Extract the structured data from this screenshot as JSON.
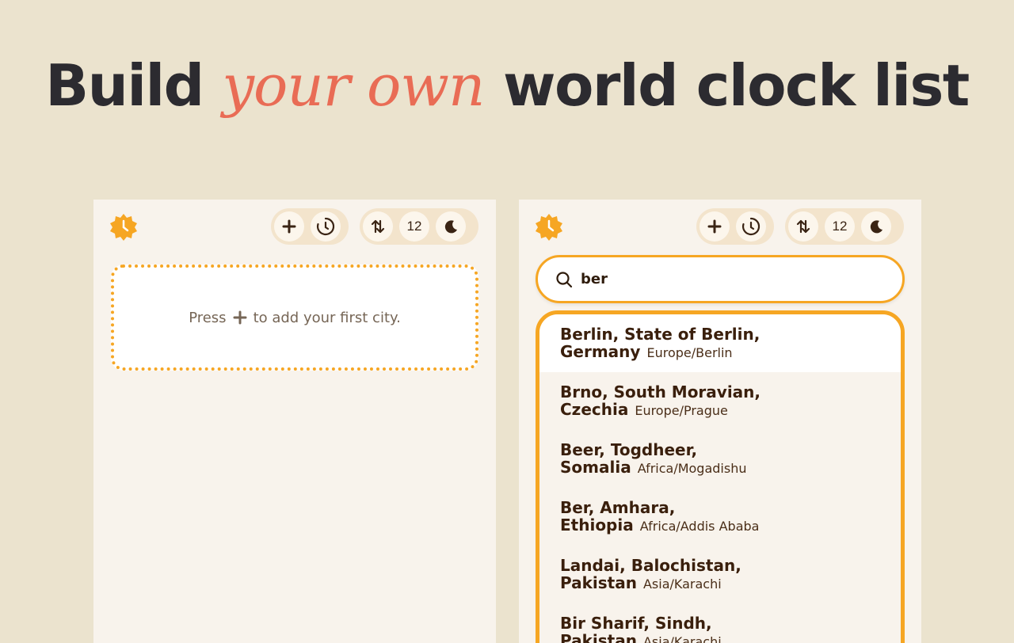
{
  "headline": {
    "before": "Build",
    "accent": "your own",
    "after": "world clock list"
  },
  "colors": {
    "background": "#ebe3ce",
    "panel": "#f8f3ec",
    "accent_orange": "#f6a623",
    "accent_coral": "#e96c55",
    "text_dark": "#2c2b30",
    "text_brown": "#3a1f0c"
  },
  "toolbar": {
    "add_icon": "plus-icon",
    "time_icon": "clock-rewind-icon",
    "sort_icon": "sort-arrows-icon",
    "format_label": "12",
    "theme_icon": "moon-icon"
  },
  "left_panel": {
    "empty_before": "Press",
    "empty_after": "to add your first city."
  },
  "right_panel": {
    "search": {
      "value": "ber",
      "icon": "search-icon"
    },
    "results": [
      {
        "line1": "Berlin, State of Berlin,",
        "line2": "Germany",
        "timezone": "Europe/Berlin",
        "selected": true
      },
      {
        "line1": "Brno, South Moravian,",
        "line2": "Czechia",
        "timezone": "Europe/Prague"
      },
      {
        "line1": "Beer, Togdheer,",
        "line2": "Somalia",
        "timezone": "Africa/Mogadishu"
      },
      {
        "line1": "Ber, Amhara,",
        "line2": "Ethiopia",
        "timezone": "Africa/Addis Ababa"
      },
      {
        "line1": "Landai, Balochistan,",
        "line2": "Pakistan",
        "timezone": "Asia/Karachi"
      },
      {
        "line1": "Bir Sharif, Sindh,",
        "line2": "Pakistan",
        "timezone": "Asia/Karachi"
      }
    ]
  }
}
